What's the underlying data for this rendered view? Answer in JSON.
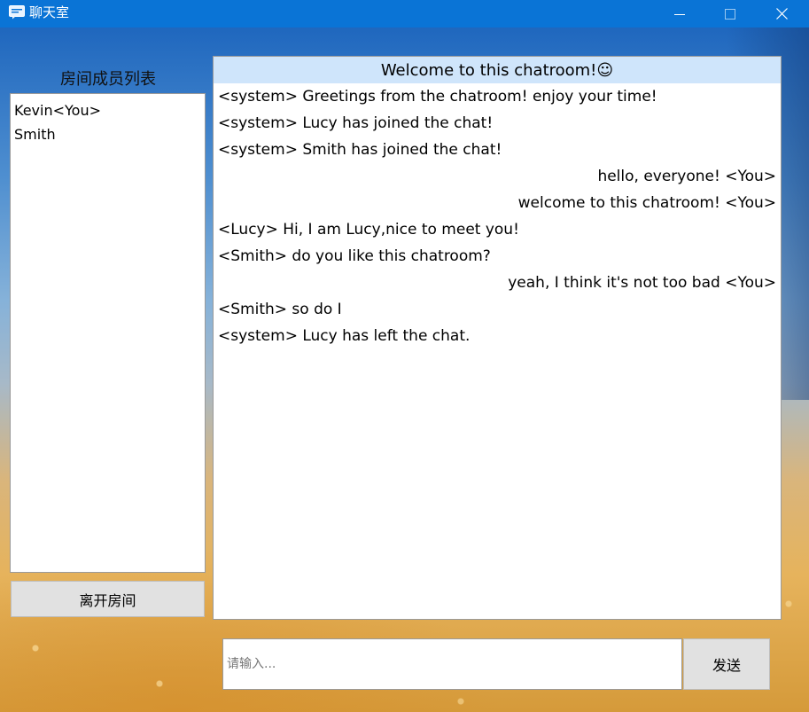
{
  "window": {
    "title": "聊天室",
    "controls": {
      "minimize_icon": "minimize-icon",
      "maximize_icon": "maximize-icon",
      "close_icon": "close-icon"
    }
  },
  "members": {
    "heading": "房间成员列表",
    "items": [
      {
        "label": "Kevin<You>"
      },
      {
        "label": "Smith"
      }
    ],
    "leave_label": "离开房间"
  },
  "chat": {
    "header": "Welcome to this chatroom!☺",
    "messages": [
      {
        "text": "<system> Greetings from the chatroom! enjoy your time!",
        "align": "left"
      },
      {
        "text": "<system> Lucy has joined the chat!",
        "align": "left"
      },
      {
        "text": "<system> Smith has joined the chat!",
        "align": "left"
      },
      {
        "text": "hello, everyone! <You>",
        "align": "right"
      },
      {
        "text": "welcome to this chatroom! <You>",
        "align": "right"
      },
      {
        "text": "<Lucy> Hi, I am Lucy,nice to meet you!",
        "align": "left"
      },
      {
        "text": "<Smith> do you like this chatroom?",
        "align": "left"
      },
      {
        "text": "yeah, I think it's not too bad <You>",
        "align": "right"
      },
      {
        "text": "<Smith> so do I",
        "align": "left"
      },
      {
        "text": "<system> Lucy has left the chat.",
        "align": "left"
      }
    ]
  },
  "input": {
    "placeholder": "请输入...",
    "value": "",
    "send_label": "发送"
  },
  "colors": {
    "titlebar": "#0a74d6",
    "chat_header_bg": "#cfe5fb",
    "button_bg": "#e1e1e1"
  }
}
